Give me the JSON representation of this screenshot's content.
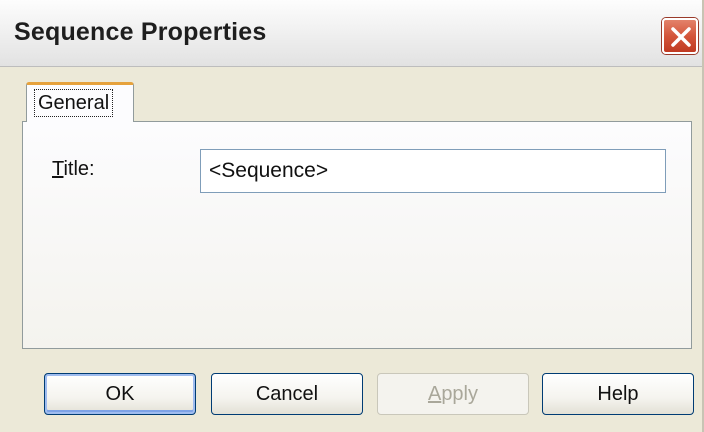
{
  "window": {
    "title": "Sequence Properties"
  },
  "tabs": [
    {
      "label": "General",
      "selected": true
    }
  ],
  "form": {
    "title_label_accel": "T",
    "title_label_rest": "itle:",
    "title_value": "<Sequence>"
  },
  "buttons": {
    "ok": {
      "label": "OK"
    },
    "cancel": {
      "label": "Cancel"
    },
    "apply": {
      "accel": "A",
      "rest": "pply",
      "enabled": false
    },
    "help": {
      "label": "Help"
    }
  },
  "colors": {
    "dialog_bg": "#ece9d8",
    "tab_highlight": "#e6a23c",
    "close_button": "#d4553a",
    "default_button_focus": "#7da2e6"
  }
}
